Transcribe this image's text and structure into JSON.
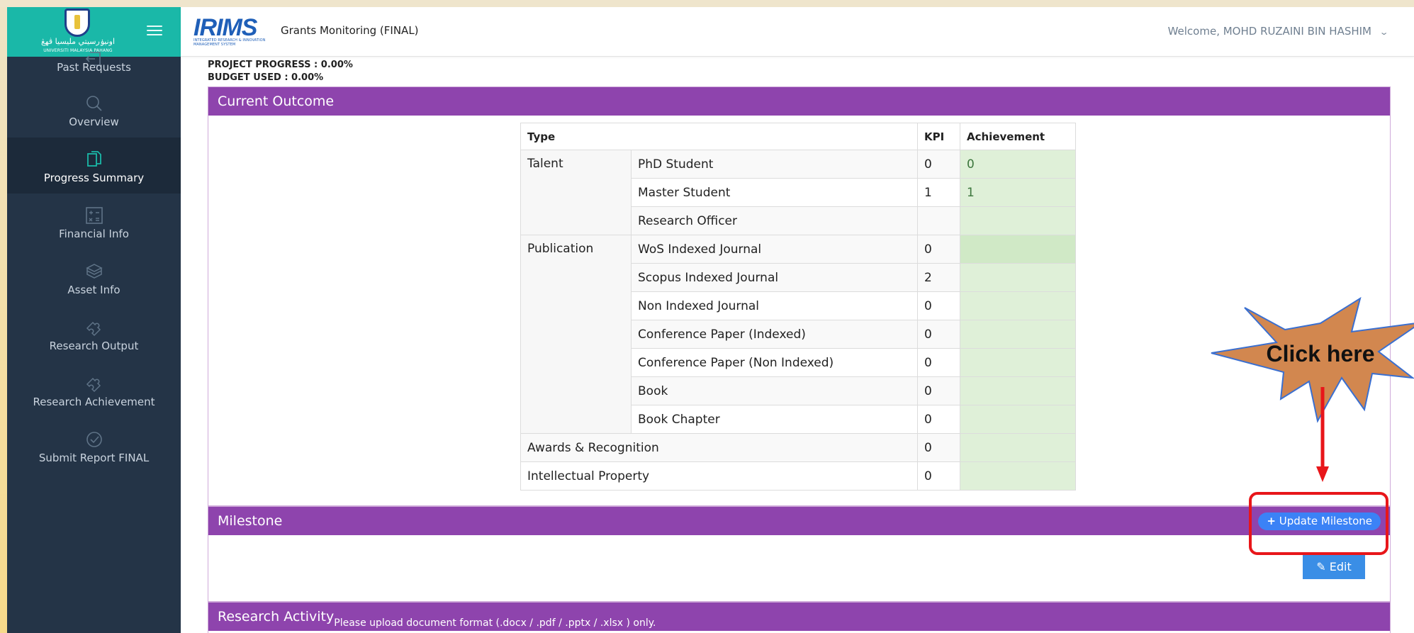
{
  "sidebar": {
    "logo_text_line1": "اونيۏرسيتي مليسيا ڤهڠ",
    "logo_text_line2": "UNIVERSITI MALAYSIA PAHANG",
    "items": [
      {
        "label": "Past Requests",
        "icon": "arrow-left-box-icon",
        "active": false
      },
      {
        "label": "Overview",
        "icon": "search-icon",
        "active": false
      },
      {
        "label": "Progress Summary",
        "icon": "documents-icon",
        "active": true
      },
      {
        "label": "Financial Info",
        "icon": "calculator-icon",
        "active": false
      },
      {
        "label": "Asset Info",
        "icon": "cubes-icon",
        "active": false
      },
      {
        "label": "Research Output",
        "icon": "puzzle-icon",
        "active": false
      },
      {
        "label": "Research Achievement",
        "icon": "puzzle-icon",
        "active": false
      },
      {
        "label": "Submit Report FINAL",
        "icon": "check-circle-icon",
        "active": false
      }
    ]
  },
  "header": {
    "brand": "IRIMS",
    "brand_sub": "INTEGRATED RESEARCH & INNOVATION MANAGEMENT SYSTEM",
    "title": "Grants Monitoring (FINAL)",
    "welcome": "Welcome, MOHD RUZAINI BIN HASHIM"
  },
  "progress": {
    "project_progress": "PROJECT PROGRESS : 0.00%",
    "budget_used": "BUDGET USED : 0.00%"
  },
  "outcome": {
    "heading": "Current Outcome",
    "columns": {
      "type": "Type",
      "kpi": "KPI",
      "achievement": "Achievement"
    },
    "rows": [
      {
        "group": "Talent",
        "item": "PhD Student",
        "kpi": "0",
        "achievement": "0"
      },
      {
        "group": "",
        "item": "Master Student",
        "kpi": "1",
        "achievement": "1"
      },
      {
        "group": "",
        "item": "Research Officer",
        "kpi": "",
        "achievement": ""
      },
      {
        "group": "Publication",
        "item": "WoS Indexed Journal",
        "kpi": "0",
        "achievement": ""
      },
      {
        "group": "",
        "item": "Scopus Indexed Journal",
        "kpi": "2",
        "achievement": ""
      },
      {
        "group": "",
        "item": "Non Indexed Journal",
        "kpi": "0",
        "achievement": ""
      },
      {
        "group": "",
        "item": "Conference Paper (Indexed)",
        "kpi": "0",
        "achievement": ""
      },
      {
        "group": "",
        "item": "Conference Paper (Non Indexed)",
        "kpi": "0",
        "achievement": ""
      },
      {
        "group": "",
        "item": "Book",
        "kpi": "0",
        "achievement": ""
      },
      {
        "group": "",
        "item": "Book Chapter",
        "kpi": "0",
        "achievement": ""
      }
    ],
    "awards": {
      "label": "Awards & Recognition",
      "kpi": "0",
      "achievement": ""
    },
    "ip": {
      "label": "Intellectual Property",
      "kpi": "0",
      "achievement": ""
    }
  },
  "milestone": {
    "heading": "Milestone",
    "update_button": "Update Milestone",
    "edit_button": "Edit"
  },
  "activity": {
    "heading": "Research Activity",
    "note": "Please upload document format (.docx / .pdf / .pptx / .xlsx ) only."
  },
  "callout": {
    "text": "Click here",
    "color": "#d2874f",
    "arrow_color": "#e8161a"
  },
  "colors": {
    "sidebar": "#243447",
    "brand": "#1ab8a8",
    "panel_header": "#8e44ad",
    "button": "#3b82f6",
    "achievement_cell": "#dff0d8"
  }
}
